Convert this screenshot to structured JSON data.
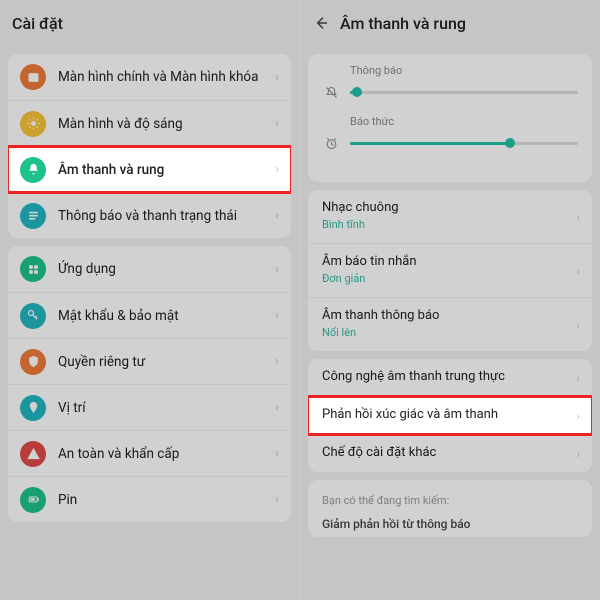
{
  "left": {
    "title": "Cài đặt",
    "groups": [
      {
        "rows": [
          {
            "icon": "image",
            "color": "#f07b3a",
            "label": "Màn hình chính và Màn hình khóa"
          },
          {
            "icon": "sun",
            "color": "#f9c23c",
            "label": "Màn hình và độ sáng"
          },
          {
            "icon": "bell",
            "color": "#1ec28b",
            "label": "Âm thanh và rung",
            "hl": true
          },
          {
            "icon": "bars",
            "color": "#22b8c2",
            "label": "Thông báo và thanh trạng thái"
          }
        ]
      },
      {
        "rows": [
          {
            "icon": "grid",
            "color": "#1ec28b",
            "label": "Ứng dụng"
          },
          {
            "icon": "key",
            "color": "#22b8c2",
            "label": "Mật khẩu & bảo mật"
          },
          {
            "icon": "shield",
            "color": "#f07b3a",
            "label": "Quyền riêng tư"
          },
          {
            "icon": "pin",
            "color": "#22b8c2",
            "label": "Vị trí"
          },
          {
            "icon": "alert",
            "color": "#e04a4a",
            "label": "An toàn và khẩn cấp"
          },
          {
            "icon": "battery",
            "color": "#1ec28b",
            "label": "Pin"
          }
        ]
      }
    ]
  },
  "right": {
    "title": "Âm thanh và rung",
    "sliders": [
      {
        "label": "Thông báo",
        "icon": "bell-off",
        "value": 0.03
      },
      {
        "label": "Báo thức",
        "icon": "alarm",
        "value": 0.7
      }
    ],
    "group1": [
      {
        "title": "Nhạc chuông",
        "sub": "Bình tĩnh"
      },
      {
        "title": "Âm báo tin nhắn",
        "sub": "Đơn giản"
      },
      {
        "title": "Âm thanh thông báo",
        "sub": "Nổi lên"
      }
    ],
    "group2": [
      {
        "title": "Công nghệ âm thanh trung thực"
      },
      {
        "title": "Phản hồi xúc giác và âm thanh",
        "hl": true
      },
      {
        "title": "Chế độ cài đặt khác"
      }
    ],
    "hint": {
      "line1": "Bạn có thể đang tìm kiếm:",
      "line2": "Giảm phản hồi từ thông báo"
    }
  }
}
